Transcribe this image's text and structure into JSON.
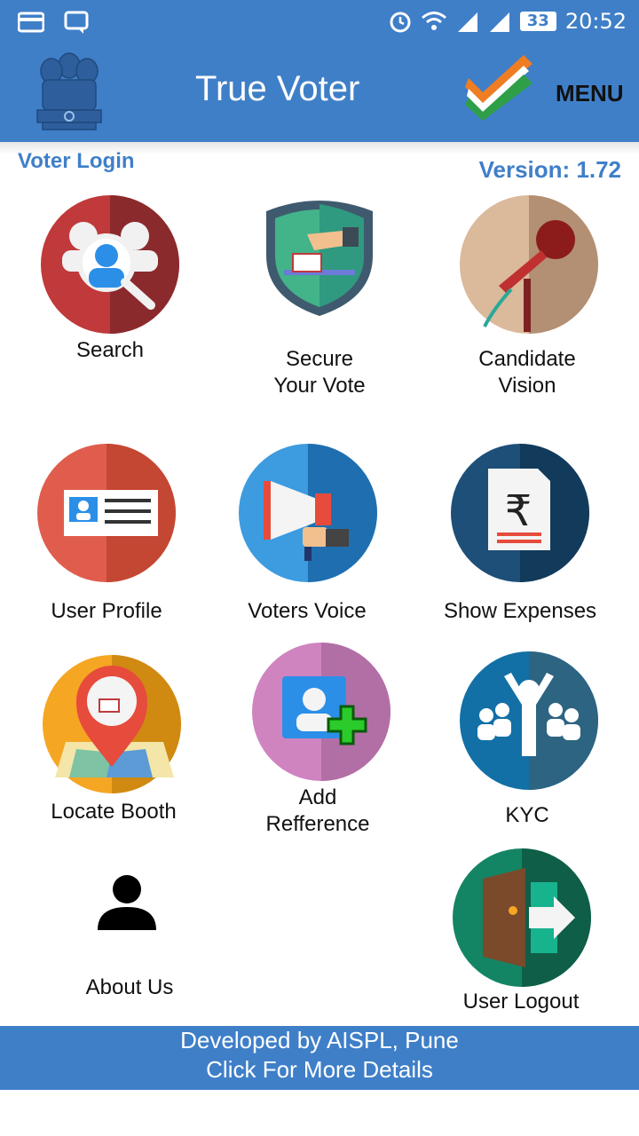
{
  "status_bar": {
    "time": "20:52",
    "battery": "33"
  },
  "app_bar": {
    "title": "True Voter",
    "menu_label": "MENU"
  },
  "header": {
    "login_label": "Voter Login",
    "version": "Version: 1.72"
  },
  "tiles": {
    "search": "Search",
    "secure_vote": "Secure\n Your Vote",
    "candidate_vision": "Candidate\nVision",
    "user_profile": "User Profile",
    "voters_voice": "Voters Voice",
    "show_expenses": "Show Expenses",
    "locate_booth": "Locate Booth",
    "add_reference": "Add\nRefference",
    "kyc": "KYC",
    "about_us": "About Us",
    "user_logout": "User Logout"
  },
  "footer": {
    "line1": "Developed by AISPL, Pune",
    "line2": "Click For More Details"
  },
  "colors": {
    "primary": "#3f7fc8"
  }
}
